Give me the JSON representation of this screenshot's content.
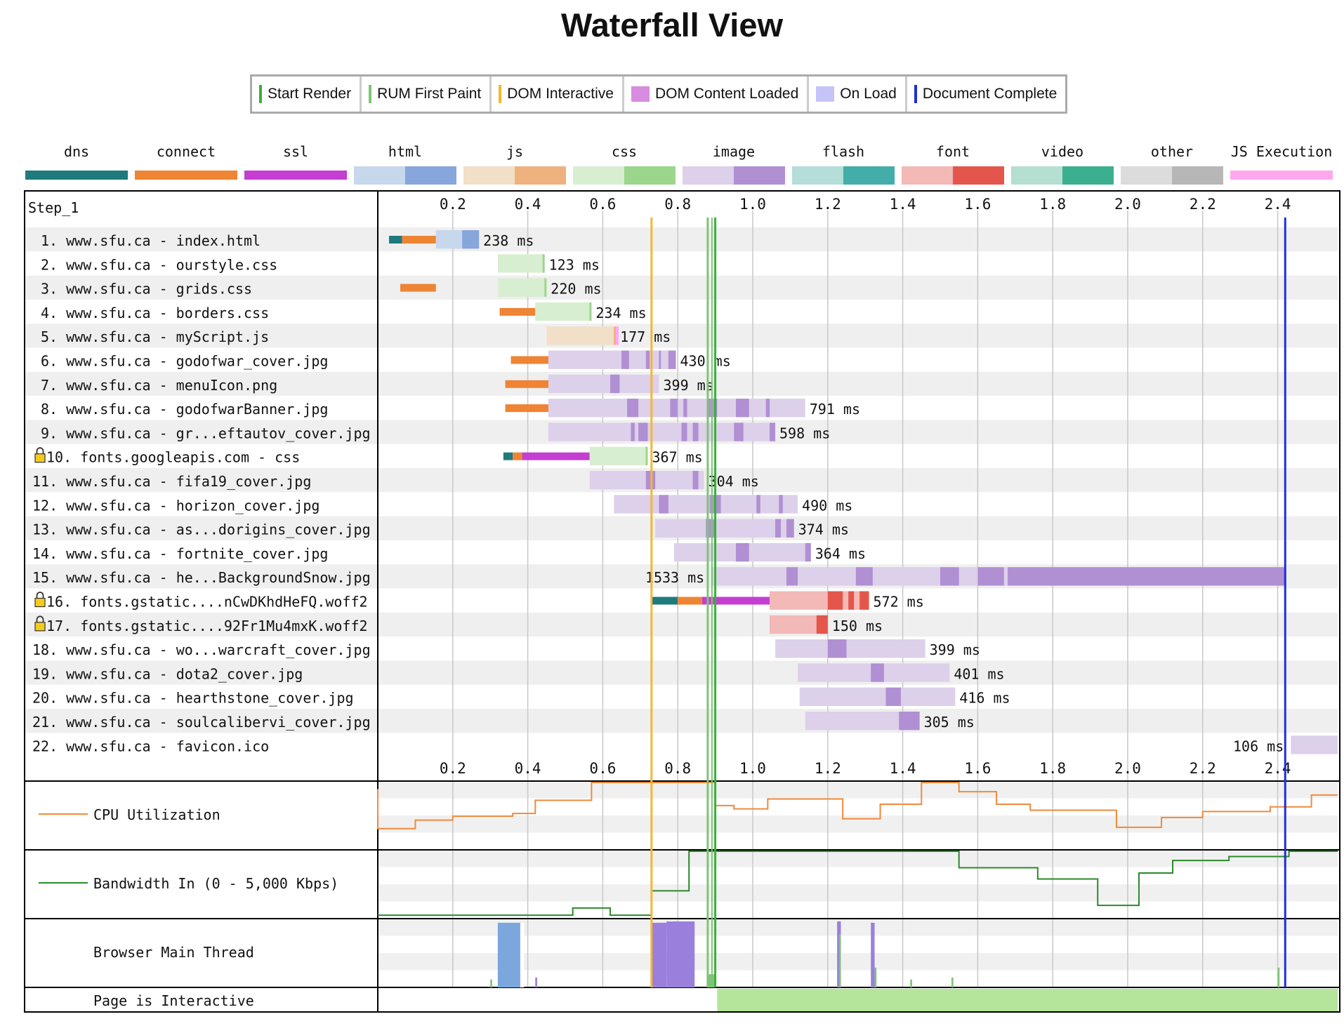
{
  "title": "Waterfall View",
  "milestones": [
    {
      "label": "Start Render",
      "color": "#39b03a",
      "kind": "line"
    },
    {
      "label": "RUM First Paint",
      "color": "#7ec476",
      "kind": "line"
    },
    {
      "label": "DOM Interactive",
      "color": "#f5b730",
      "kind": "line"
    },
    {
      "label": "DOM Content Loaded",
      "color": "#d78ce0",
      "kind": "block"
    },
    {
      "label": "On Load",
      "color": "#c4c4f8",
      "kind": "block"
    },
    {
      "label": "Document Complete",
      "color": "#1d2fd6",
      "kind": "line"
    }
  ],
  "content_types": [
    {
      "label": "dns",
      "light": "#1f7a7e",
      "dark": "#1f7a7e"
    },
    {
      "label": "connect",
      "light": "#ee8434",
      "dark": "#ee8434"
    },
    {
      "label": "ssl",
      "light": "#c43ed1",
      "dark": "#c43ed1"
    },
    {
      "label": "html",
      "light": "#c7d7ec",
      "dark": "#86a6dc"
    },
    {
      "label": "js",
      "light": "#f2dfc8",
      "dark": "#eeb27f"
    },
    {
      "label": "css",
      "light": "#d8eed0",
      "dark": "#9bd68c"
    },
    {
      "label": "image",
      "light": "#ddd0ea",
      "dark": "#b08fd3"
    },
    {
      "label": "flash",
      "light": "#b5ddda",
      "dark": "#42ada9"
    },
    {
      "label": "font",
      "light": "#f2b9b7",
      "dark": "#e4564c"
    },
    {
      "label": "video",
      "light": "#b5dfd0",
      "dark": "#3cb08e"
    },
    {
      "label": "other",
      "light": "#dcdcdc",
      "dark": "#b7b7b7"
    },
    {
      "label": "JS Execution",
      "light": "#ffa8f0",
      "dark": "#ffa8f0"
    }
  ],
  "step_label": "Step_1",
  "chart_data": {
    "type": "waterfall",
    "x_unit": "seconds",
    "xlim": [
      0,
      2.56
    ],
    "ticks": [
      "0.2",
      "0.4",
      "0.6",
      "0.8",
      "1.0",
      "1.2",
      "1.4",
      "1.6",
      "1.8",
      "2.0",
      "2.2",
      "2.4"
    ],
    "milestone_times": {
      "DOM Interactive": 0.73,
      "RUM First Paint": 0.88,
      "Start Render": 0.9,
      "Document Complete": 2.42
    },
    "requests": [
      {
        "label": "1. www.sfu.ca - index.html",
        "type": "html",
        "lock": false,
        "dns": [
          0.03,
          0.065
        ],
        "connect": [
          0.065,
          0.155
        ],
        "start": 0.155,
        "end": 0.27,
        "dur": "238 ms",
        "label_side": "right"
      },
      {
        "label": "2. www.sfu.ca - ourstyle.css",
        "type": "css",
        "lock": false,
        "start": 0.32,
        "end": 0.445,
        "dur": "123 ms",
        "label_side": "right"
      },
      {
        "label": "3. www.sfu.ca - grids.css",
        "type": "css",
        "lock": false,
        "connect": [
          0.06,
          0.155
        ],
        "start": 0.32,
        "end": 0.45,
        "dur": "220 ms",
        "label_side": "right"
      },
      {
        "label": "4. www.sfu.ca - borders.css",
        "type": "css",
        "lock": false,
        "connect": [
          0.325,
          0.42
        ],
        "start": 0.42,
        "end": 0.57,
        "dur": "234 ms",
        "label_side": "right"
      },
      {
        "label": "5. www.sfu.ca - myScript.js",
        "type": "js",
        "lock": false,
        "start": 0.45,
        "end": 0.635,
        "dur": "177 ms",
        "label_side": "right",
        "js_exec": [
          0.635,
          0.64
        ]
      },
      {
        "label": "6. www.sfu.ca - godofwar_cover.jpg",
        "type": "image",
        "lock": false,
        "connect": [
          0.355,
          0.455
        ],
        "start": 0.455,
        "end": 0.795,
        "dur": "430 ms",
        "label_side": "right",
        "chunks": [
          [
            0.65,
            0.67
          ],
          [
            0.715,
            0.725
          ],
          [
            0.75,
            0.755
          ],
          [
            0.775,
            0.795
          ]
        ]
      },
      {
        "label": "7. www.sfu.ca - menuIcon.png",
        "type": "image",
        "lock": false,
        "connect": [
          0.34,
          0.455
        ],
        "start": 0.455,
        "end": 0.75,
        "dur": "399 ms",
        "label_side": "right",
        "chunks": [
          [
            0.62,
            0.645
          ]
        ]
      },
      {
        "label": "8. www.sfu.ca - godofwarBanner.jpg",
        "type": "image",
        "lock": false,
        "connect": [
          0.34,
          0.455
        ],
        "start": 0.455,
        "end": 1.14,
        "dur": "791 ms",
        "label_side": "right",
        "chunks": [
          [
            0.665,
            0.695
          ],
          [
            0.78,
            0.8
          ],
          [
            0.815,
            0.825
          ],
          [
            0.88,
            0.905
          ],
          [
            0.955,
            0.99
          ],
          [
            1.035,
            1.045
          ]
        ]
      },
      {
        "label": "9. www.sfu.ca - gr...eftautov_cover.jpg",
        "type": "image",
        "lock": false,
        "start": 0.455,
        "end": 1.06,
        "dur": "598 ms",
        "label_side": "right",
        "chunks": [
          [
            0.675,
            0.685
          ],
          [
            0.695,
            0.72
          ],
          [
            0.81,
            0.825
          ],
          [
            0.84,
            0.855
          ],
          [
            0.95,
            0.975
          ],
          [
            1.045,
            1.06
          ]
        ]
      },
      {
        "label": "10. fonts.googleapis.com - css",
        "type": "css",
        "lock": true,
        "dns": [
          0.335,
          0.36
        ],
        "connect": [
          0.36,
          0.385
        ],
        "ssl": [
          0.385,
          0.565
        ],
        "start": 0.565,
        "end": 0.72,
        "dur": "367 ms",
        "label_side": "right"
      },
      {
        "label": "11. www.sfu.ca - fifa19_cover.jpg",
        "type": "image",
        "lock": false,
        "start": 0.565,
        "end": 0.87,
        "dur": "304 ms",
        "label_side": "right",
        "chunks": [
          [
            0.715,
            0.74
          ],
          [
            0.84,
            0.855
          ]
        ]
      },
      {
        "label": "12. www.sfu.ca - horizon_cover.jpg",
        "type": "image",
        "lock": false,
        "start": 0.63,
        "end": 1.12,
        "dur": "490 ms",
        "label_side": "right",
        "chunks": [
          [
            0.75,
            0.775
          ],
          [
            0.885,
            0.915
          ],
          [
            1.01,
            1.02
          ],
          [
            1.07,
            1.08
          ]
        ]
      },
      {
        "label": "13. www.sfu.ca - as...dorigins_cover.jpg",
        "type": "image",
        "lock": false,
        "start": 0.74,
        "end": 1.11,
        "dur": "374 ms",
        "label_side": "right",
        "chunks": [
          [
            0.875,
            0.9
          ],
          [
            1.06,
            1.075
          ],
          [
            1.09,
            1.11
          ]
        ]
      },
      {
        "label": "14. www.sfu.ca - fortnite_cover.jpg",
        "type": "image",
        "lock": false,
        "start": 0.79,
        "end": 1.155,
        "dur": "364 ms",
        "label_side": "right",
        "chunks": [
          [
            0.955,
            0.99
          ],
          [
            1.14,
            1.155
          ]
        ]
      },
      {
        "label": "15. www.sfu.ca - he...BackgroundSnow.jpg",
        "type": "image",
        "lock": false,
        "start": 0.89,
        "end": 2.42,
        "dur": "1533 ms",
        "label_side": "left",
        "chunks": [
          [
            1.09,
            1.12
          ],
          [
            1.275,
            1.32
          ],
          [
            1.5,
            1.55
          ],
          [
            1.6,
            1.67
          ],
          [
            1.68,
            2.42
          ]
        ]
      },
      {
        "label": "16. fonts.gstatic....nCwDKhdHeFQ.woff2",
        "type": "font",
        "lock": true,
        "dns": [
          0.73,
          0.8
        ],
        "connect": [
          0.8,
          0.865
        ],
        "ssl": [
          0.865,
          1.045
        ],
        "start": 1.045,
        "end": 1.31,
        "dur": "572 ms",
        "label_side": "right",
        "chunks": [
          [
            1.2,
            1.24
          ],
          [
            1.255,
            1.27
          ],
          [
            1.285,
            1.31
          ]
        ]
      },
      {
        "label": "17. fonts.gstatic....92Fr1Mu4mxK.woff2",
        "type": "font",
        "lock": true,
        "start": 1.045,
        "end": 1.2,
        "dur": "150 ms",
        "label_side": "right",
        "chunks": [
          [
            1.17,
            1.2
          ]
        ]
      },
      {
        "label": "18. www.sfu.ca - wo...warcraft_cover.jpg",
        "type": "image",
        "lock": false,
        "start": 1.06,
        "end": 1.46,
        "dur": "399 ms",
        "label_side": "right",
        "chunks": [
          [
            1.2,
            1.25
          ]
        ]
      },
      {
        "label": "19. www.sfu.ca - dota2_cover.jpg",
        "type": "image",
        "lock": false,
        "start": 1.12,
        "end": 1.525,
        "dur": "401 ms",
        "label_side": "right",
        "chunks": [
          [
            1.315,
            1.35
          ]
        ]
      },
      {
        "label": "20. www.sfu.ca - hearthstone_cover.jpg",
        "type": "image",
        "lock": false,
        "start": 1.125,
        "end": 1.54,
        "dur": "416 ms",
        "label_side": "right",
        "chunks": [
          [
            1.355,
            1.395
          ]
        ]
      },
      {
        "label": "21. www.sfu.ca - soulcalibervi_cover.jpg",
        "type": "image",
        "lock": false,
        "start": 1.14,
        "end": 1.445,
        "dur": "305 ms",
        "label_side": "right",
        "chunks": [
          [
            1.39,
            1.445
          ]
        ]
      },
      {
        "label": "22. www.sfu.ca - favicon.ico",
        "type": "image",
        "lock": false,
        "start": 2.435,
        "end": 2.56,
        "dur": "106 ms",
        "label_side": "left"
      }
    ],
    "cpu": {
      "label": "CPU Utilization",
      "color": "#f08a3c",
      "points": [
        [
          0.0,
          0.1
        ],
        [
          0.0,
          0.7
        ],
        [
          0.1,
          0.7
        ],
        [
          0.1,
          0.57
        ],
        [
          0.2,
          0.57
        ],
        [
          0.2,
          0.51
        ],
        [
          0.36,
          0.51
        ],
        [
          0.36,
          0.47
        ],
        [
          0.42,
          0.47
        ],
        [
          0.42,
          0.27
        ],
        [
          0.57,
          0.27
        ],
        [
          0.57,
          0.0
        ],
        [
          0.9,
          0.0
        ],
        [
          0.9,
          0.35
        ],
        [
          0.95,
          0.35
        ],
        [
          0.95,
          0.4
        ],
        [
          1.04,
          0.4
        ],
        [
          1.04,
          0.25
        ],
        [
          1.24,
          0.25
        ],
        [
          1.24,
          0.55
        ],
        [
          1.34,
          0.55
        ],
        [
          1.34,
          0.33
        ],
        [
          1.45,
          0.33
        ],
        [
          1.45,
          0.0
        ],
        [
          1.55,
          0.0
        ],
        [
          1.55,
          0.14
        ],
        [
          1.65,
          0.14
        ],
        [
          1.65,
          0.33
        ],
        [
          1.74,
          0.33
        ],
        [
          1.74,
          0.42
        ],
        [
          1.97,
          0.42
        ],
        [
          1.97,
          0.68
        ],
        [
          2.09,
          0.68
        ],
        [
          2.09,
          0.53
        ],
        [
          2.2,
          0.53
        ],
        [
          2.2,
          0.44
        ],
        [
          2.38,
          0.44
        ],
        [
          2.38,
          0.37
        ],
        [
          2.49,
          0.37
        ],
        [
          2.49,
          0.19
        ],
        [
          2.56,
          0.19
        ]
      ]
    },
    "bandwidth": {
      "label": "Bandwidth In (0 - 5,000 Kbps)",
      "color": "#2a8a2a",
      "points": [
        [
          0.0,
          0.97
        ],
        [
          0.52,
          0.97
        ],
        [
          0.52,
          0.86
        ],
        [
          0.62,
          0.86
        ],
        [
          0.62,
          0.97
        ],
        [
          0.73,
          0.97
        ],
        [
          0.73,
          0.6
        ],
        [
          0.83,
          0.6
        ],
        [
          0.83,
          0.0
        ],
        [
          1.55,
          0.0
        ],
        [
          1.55,
          0.25
        ],
        [
          1.76,
          0.25
        ],
        [
          1.76,
          0.42
        ],
        [
          1.92,
          0.42
        ],
        [
          1.92,
          0.82
        ],
        [
          2.03,
          0.82
        ],
        [
          2.03,
          0.33
        ],
        [
          2.12,
          0.33
        ],
        [
          2.12,
          0.14
        ],
        [
          2.27,
          0.14
        ],
        [
          2.27,
          0.08
        ],
        [
          2.43,
          0.08
        ],
        [
          2.43,
          0.0
        ],
        [
          2.56,
          0.0
        ]
      ]
    },
    "main_thread": {
      "label": "Browser Main Thread",
      "segments": [
        {
          "start": 0.32,
          "end": 0.385,
          "color": "#7ba7dd",
          "h": 0.98
        },
        {
          "start": 0.38,
          "end": 0.39,
          "color": "#ffffff",
          "h": 0.98
        },
        {
          "start": 0.73,
          "end": 0.77,
          "color": "#9b7fdc",
          "h": 0.98
        },
        {
          "start": 0.77,
          "end": 0.845,
          "color": "#9b7fdc",
          "h": 1.0
        },
        {
          "start": 1.225,
          "end": 1.235,
          "color": "#9b7fdc",
          "h": 1.0
        },
        {
          "start": 1.315,
          "end": 1.325,
          "color": "#9b7fdc",
          "h": 0.98
        },
        {
          "start": 0.42,
          "end": 0.425,
          "color": "#9b7fdc",
          "h": 0.15
        },
        {
          "start": 0.3,
          "end": 0.305,
          "color": "#7ec476",
          "h": 0.12
        },
        {
          "start": 0.88,
          "end": 0.9,
          "color": "#7ec476",
          "h": 0.2
        },
        {
          "start": 1.23,
          "end": 1.235,
          "color": "#7ec476",
          "h": 0.8
        },
        {
          "start": 1.325,
          "end": 1.33,
          "color": "#7ec476",
          "h": 0.3
        },
        {
          "start": 1.42,
          "end": 1.425,
          "color": "#7ec476",
          "h": 0.12
        },
        {
          "start": 1.53,
          "end": 1.535,
          "color": "#7ec476",
          "h": 0.15
        },
        {
          "start": 2.4,
          "end": 2.405,
          "color": "#7ec476",
          "h": 0.3
        }
      ]
    },
    "page_interactive": {
      "label": "Page is Interactive",
      "start": 0.905,
      "end": 2.56,
      "color": "#b4e59a"
    }
  }
}
